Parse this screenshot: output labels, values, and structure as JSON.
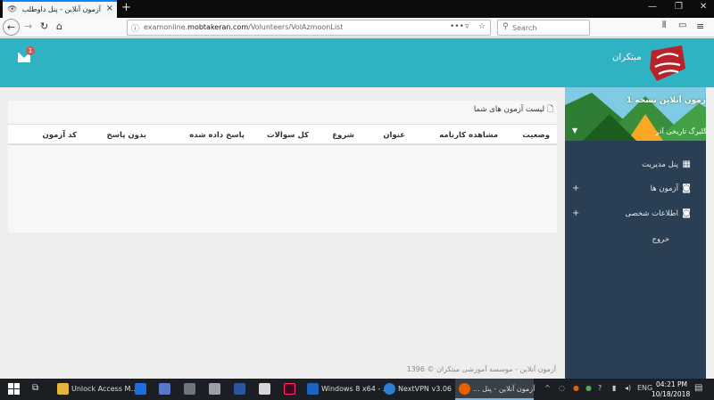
{
  "browser": {
    "tab_title": "آزمون آنلاین - پنل داوطلب",
    "url_prefix": "examonline.",
    "url_host": "mobtakeran.com",
    "url_path": "/Volunteers/VolAzmoonList",
    "search_placeholder": "Search"
  },
  "header": {
    "brand_name": "مبتکران",
    "mail_badge": "1",
    "logo_text": "مبتکران"
  },
  "sidebar": {
    "banner_title": "آزمون آنلاین نسخه 1",
    "user_name": "گلبرگ تاریخی آذر",
    "items": [
      {
        "label": "پنل مدیریت",
        "icon": "grid-icon"
      },
      {
        "label": "آزمون ها",
        "icon": "camera-icon"
      },
      {
        "label": "اطلاعات شخصی",
        "icon": "camera-icon"
      },
      {
        "label": "خروج"
      }
    ]
  },
  "main": {
    "panel_title": "لیست آزمون های شما",
    "columns": [
      "وضعیت",
      "مشاهده کارنامه",
      "عنوان",
      "شروع",
      "کل سوالات",
      "پاسخ داده شده",
      "بدون پاسخ",
      "کد آزمون"
    ],
    "footer": "آزمون آنلاین - موسسه آموزشی مبتکران © 1396"
  },
  "taskbar": {
    "items": [
      {
        "label": "Unlock Access M..."
      },
      {
        "label": "Windows 8 x64 - ..."
      },
      {
        "label": "NextVPN v3.06"
      },
      {
        "label": "آزمون آنلاین - پنل ..."
      }
    ],
    "lang": "ENG",
    "time": "04:21 PM",
    "date": "10/18/2018"
  }
}
